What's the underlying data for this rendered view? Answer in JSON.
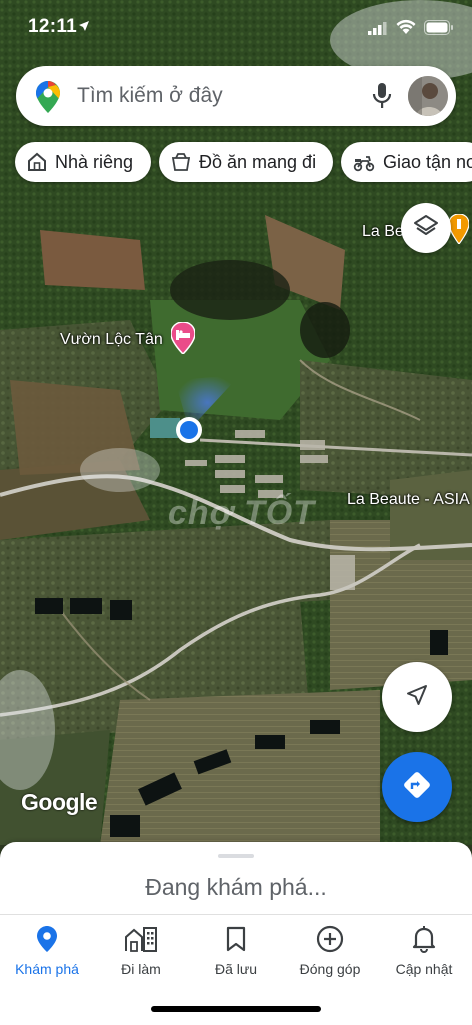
{
  "status_bar": {
    "time": "12:11",
    "icons": [
      "location-arrow-icon",
      "signal-icon",
      "wifi-icon",
      "battery-icon"
    ]
  },
  "search": {
    "placeholder": "Tìm kiếm ở đây",
    "icons": [
      "maps-pin-icon",
      "mic-icon"
    ],
    "avatar": "profile-avatar"
  },
  "chips": [
    {
      "label": "Nhà riêng",
      "icon": "home-icon"
    },
    {
      "label": "Đồ ăn mang đi",
      "icon": "takeout-icon"
    },
    {
      "label": "Giao tận nơ",
      "icon": "delivery-scooter-icon"
    }
  ],
  "map": {
    "type": "satellite",
    "labels": [
      {
        "text": "Vườn Lộc Tân",
        "icon": "hotel-bed-icon"
      },
      {
        "text": "La Be",
        "icon": "place-pin-icon"
      },
      {
        "text": "La Beaute - ASIA"
      }
    ],
    "watermark": "chợ TỐT",
    "logo": "Google",
    "accent_color": "#1a73e8",
    "marker_color": "#ea4c89"
  },
  "controls": {
    "layers_icon": "layers-icon",
    "compass_icon": "compass-arrow-icon",
    "directions_icon": "directions-icon"
  },
  "sheet": {
    "status_text": "Đang khám phá..."
  },
  "bottom_nav": {
    "active": "Khám phá",
    "items": [
      {
        "label": "Khám phá",
        "icon": "explore-pin-icon"
      },
      {
        "label": "Đi làm",
        "icon": "commute-icon"
      },
      {
        "label": "Đã lưu",
        "icon": "bookmark-icon"
      },
      {
        "label": "Đóng góp",
        "icon": "add-circle-icon"
      },
      {
        "label": "Cập nhật",
        "icon": "bell-icon"
      }
    ]
  }
}
